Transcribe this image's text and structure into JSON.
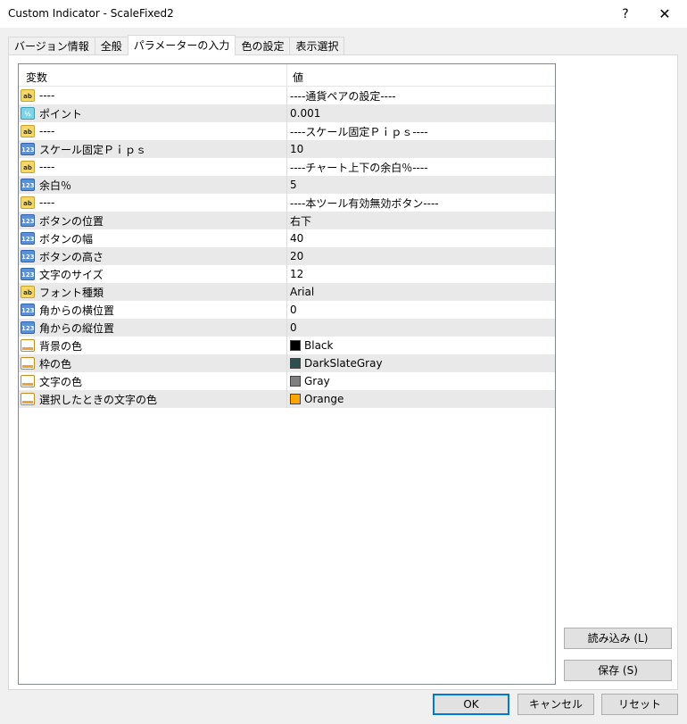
{
  "window": {
    "title": "Custom Indicator - ScaleFixed2",
    "help": "?",
    "close": "✕"
  },
  "tabs": [
    {
      "label": "バージョン情報"
    },
    {
      "label": "全般"
    },
    {
      "label": "パラメーターの入力"
    },
    {
      "label": "色の設定"
    },
    {
      "label": "表示選択"
    }
  ],
  "grid": {
    "col_variable": "変数",
    "col_value": "値",
    "rows": [
      {
        "type": "ab",
        "icon": "string-icon",
        "name": "----",
        "value": "----通貨ペアの設定----"
      },
      {
        "type": "half",
        "icon": "double-icon",
        "name": "ポイント",
        "value": "0.001"
      },
      {
        "type": "ab",
        "icon": "string-icon",
        "name": "----",
        "value": "----スケール固定Ｐｉｐｓ----"
      },
      {
        "type": "num",
        "icon": "integer-icon",
        "name": "スケール固定Ｐｉｐｓ",
        "value": "10"
      },
      {
        "type": "ab",
        "icon": "string-icon",
        "name": "----",
        "value": "----チャート上下の余白％----"
      },
      {
        "type": "num",
        "icon": "integer-icon",
        "name": "余白％",
        "value": "5"
      },
      {
        "type": "ab",
        "icon": "string-icon",
        "name": "----",
        "value": "----本ツール有効無効ボタン----"
      },
      {
        "type": "num",
        "icon": "integer-icon",
        "name": "ボタンの位置",
        "value": "右下"
      },
      {
        "type": "num",
        "icon": "integer-icon",
        "name": "ボタンの幅",
        "value": "40"
      },
      {
        "type": "num",
        "icon": "integer-icon",
        "name": "ボタンの高さ",
        "value": "20"
      },
      {
        "type": "num",
        "icon": "integer-icon",
        "name": "文字のサイズ",
        "value": "12"
      },
      {
        "type": "ab",
        "icon": "string-icon",
        "name": "フォント種類",
        "value": "Arial"
      },
      {
        "type": "num",
        "icon": "integer-icon",
        "name": "角からの横位置",
        "value": "0"
      },
      {
        "type": "num",
        "icon": "integer-icon",
        "name": "角からの縦位置",
        "value": "0"
      },
      {
        "type": "color",
        "icon": "color-icon",
        "name": "背景の色",
        "value": "Black",
        "swatch": "#000000"
      },
      {
        "type": "color",
        "icon": "color-icon",
        "name": "枠の色",
        "value": "DarkSlateGray",
        "swatch": "#2f4f4f"
      },
      {
        "type": "color",
        "icon": "color-icon",
        "name": "文字の色",
        "value": "Gray",
        "swatch": "#808080"
      },
      {
        "type": "color",
        "icon": "color-icon",
        "name": "選択したときの文字の色",
        "value": "Orange",
        "swatch": "#ffa500"
      }
    ]
  },
  "buttons": {
    "load": "読み込み (L)",
    "save": "保存 (S)",
    "ok": "OK",
    "cancel": "キャンセル",
    "reset": "リセット"
  },
  "colors": {
    "accent": "#0078d7"
  }
}
